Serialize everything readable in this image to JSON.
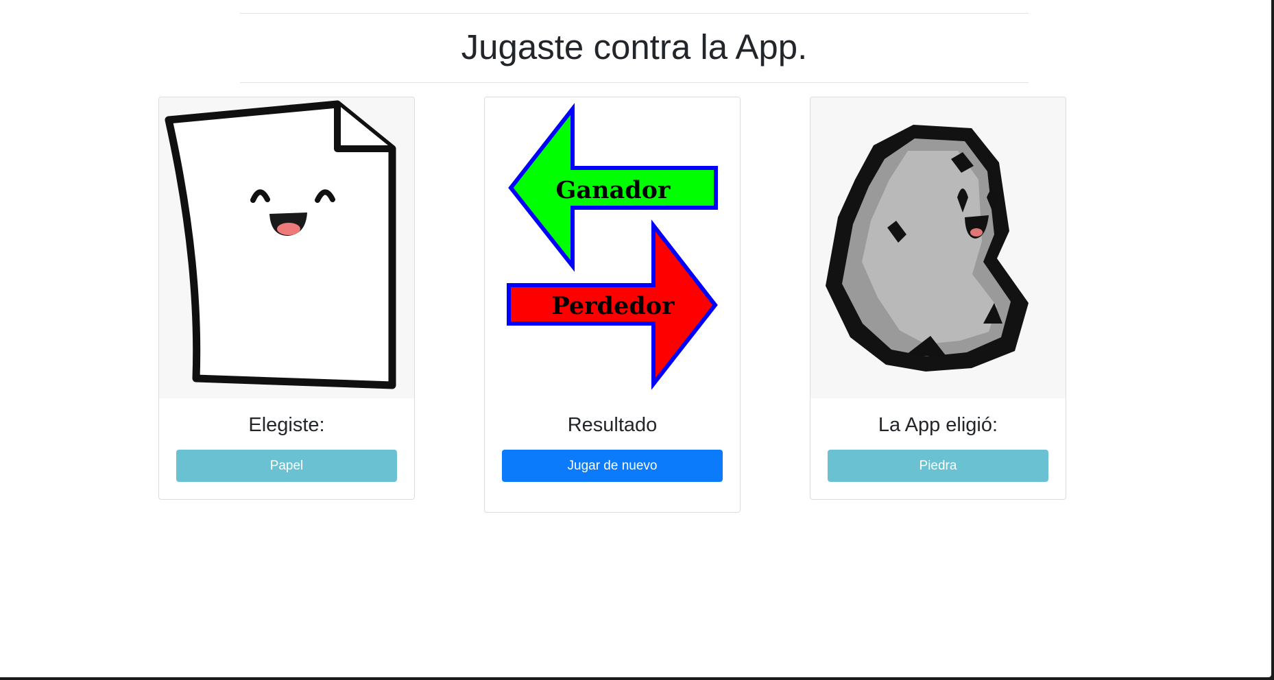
{
  "header": {
    "title": "Jugaste contra la App."
  },
  "cards": [
    {
      "title": "Elegiste:",
      "button_label": "Papel",
      "image_icon": "paper-character-icon"
    },
    {
      "title": "Resultado",
      "button_label": "Jugar de nuevo",
      "image_icon": "winner-loser-arrows-icon",
      "arrows": {
        "winner_label": "Ganador",
        "loser_label": "Perdedor",
        "winner_color": "#00ff00",
        "loser_color": "#ff0000",
        "outline_color": "#0000ff"
      }
    },
    {
      "title": "La App eligió:",
      "button_label": "Piedra",
      "image_icon": "rock-character-icon"
    }
  ],
  "colors": {
    "info_button": "#69c1d2",
    "primary_button": "#0b7bfb",
    "text": "#222529",
    "image_background": "#f7f7f7"
  }
}
